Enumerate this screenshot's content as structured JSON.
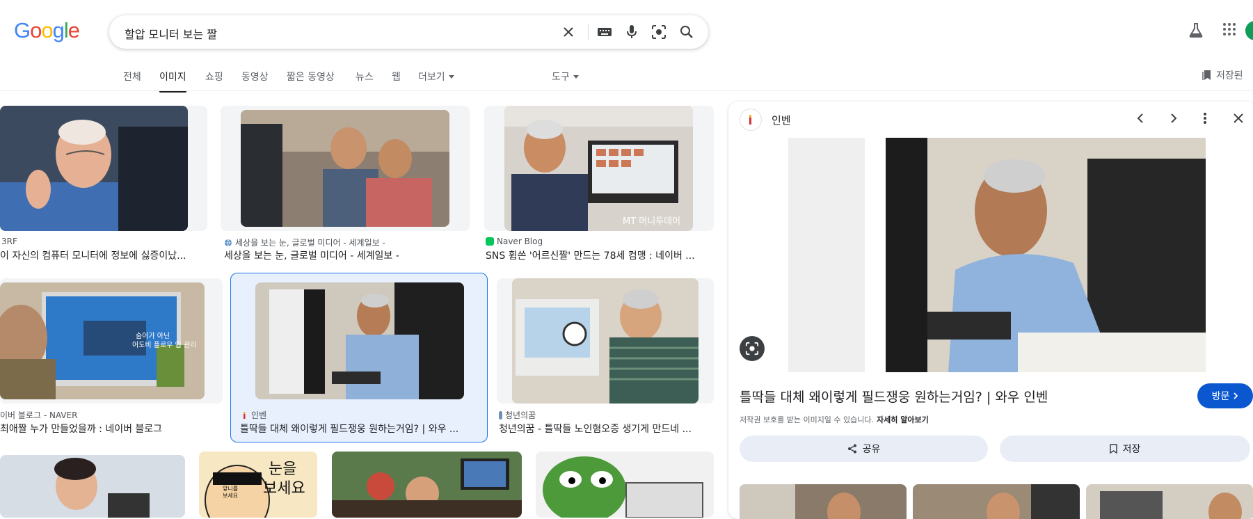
{
  "search": {
    "query": "할압 모니터 보는 짤"
  },
  "tabs": [
    {
      "label": "전체",
      "active": false
    },
    {
      "label": "이미지",
      "active": true
    },
    {
      "label": "쇼핑",
      "active": false
    },
    {
      "label": "동영상",
      "active": false
    },
    {
      "label": "짧은 동영상",
      "active": false
    },
    {
      "label": "뉴스",
      "active": false
    },
    {
      "label": "웹",
      "active": false
    },
    {
      "label": "더보기",
      "active": false
    }
  ],
  "tools_label": "도구",
  "saved_label": "저장된",
  "results": [
    {
      "source": "3RF",
      "caption": "이 자신의 컴퓨터 모니터에 정보에 싫증이났..."
    },
    {
      "source": "세상을 보는 눈, 글로벌 미디어 - 세계일보 -",
      "caption": "세상을 보는 눈, 글로벌 미디어 - 세계일보 -"
    },
    {
      "source": "Naver Blog",
      "caption": "SNS 휩쓴 '어르신짤' 만드는 78세 컴맹 : 네이버 ..."
    },
    {
      "source": "이버 블로그 - NAVER",
      "caption": "최애짤 누가 만들었을까 : 네이버 블로그"
    },
    {
      "source": "인벤",
      "caption": "틀딱들 대체 왜이렇게 필드쟁웅 원하는거임? | 와우 ..."
    },
    {
      "source": "청년의꿈",
      "caption": "청년의꿈 - 틀딱들 노인혐오증 생기게 만드네 ..."
    }
  ],
  "thumb_texts": {
    "sign_large": "눈을\n보세요",
    "sign_small": "앞니를\n보세요",
    "monitor_note": "숨어가 아닌\n어도비 플로우 입 관리"
  },
  "watermark": "MT 머니투데이",
  "panel": {
    "source": "인벤",
    "title": "틀딱들 대체 왜이렇게 필드쟁웅 원하는거임? | 와우 인벤",
    "visit_label": "방문",
    "copyright_text": "저작권 보호를 받는 이미지일 수 있습니다.",
    "learn_more": "자세히 알아보기",
    "share_label": "공유",
    "save_label": "저장"
  },
  "colors": {
    "accent": "#1a73e8",
    "visit_button": "#0b57d0",
    "action_button": "#e9eef6"
  }
}
